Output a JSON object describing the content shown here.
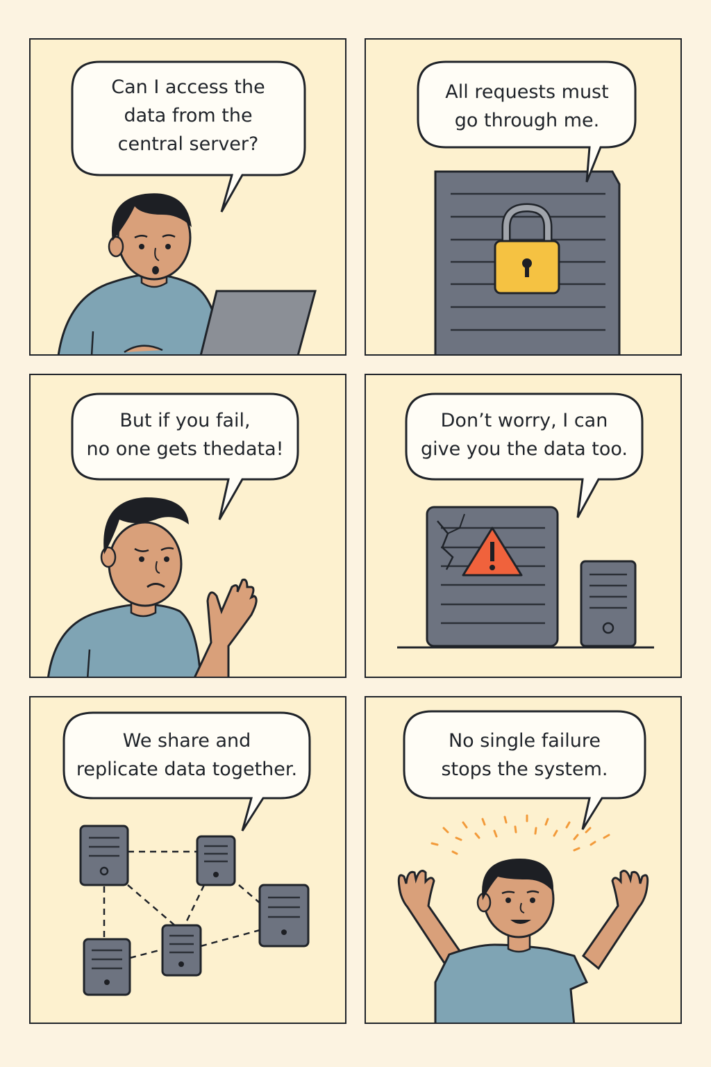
{
  "panels": [
    {
      "speaker": "user",
      "speech": "Can I access the\ndata from the\ncentral server?"
    },
    {
      "speaker": "central-server",
      "speech": "All requests must\ngo through me."
    },
    {
      "speaker": "user",
      "speech": "But if you fail,\nno one gets thedata!"
    },
    {
      "speaker": "backup-server",
      "speech": "Don’t worry, I can\ngive you the data too."
    },
    {
      "speaker": "server-network",
      "speech": "We share and\nreplicate data together."
    },
    {
      "speaker": "user",
      "speech": "No single failure\nstops the system."
    }
  ],
  "colors": {
    "panel_background": "#fdf1cf",
    "page_background": "#fcf3e1",
    "outline": "#1f2329",
    "bubble": "#fffdf6",
    "skin": "#d9a07a",
    "hair": "#1d1f24",
    "shirt": "#7fa4b4",
    "server": "#6d7380",
    "lock": "#f5c242",
    "warning": "#f0623c",
    "sparks": "#f29a3a"
  },
  "icons": [
    "padlock-icon",
    "warning-triangle-icon",
    "crack-icon",
    "sparkle-icon"
  ]
}
